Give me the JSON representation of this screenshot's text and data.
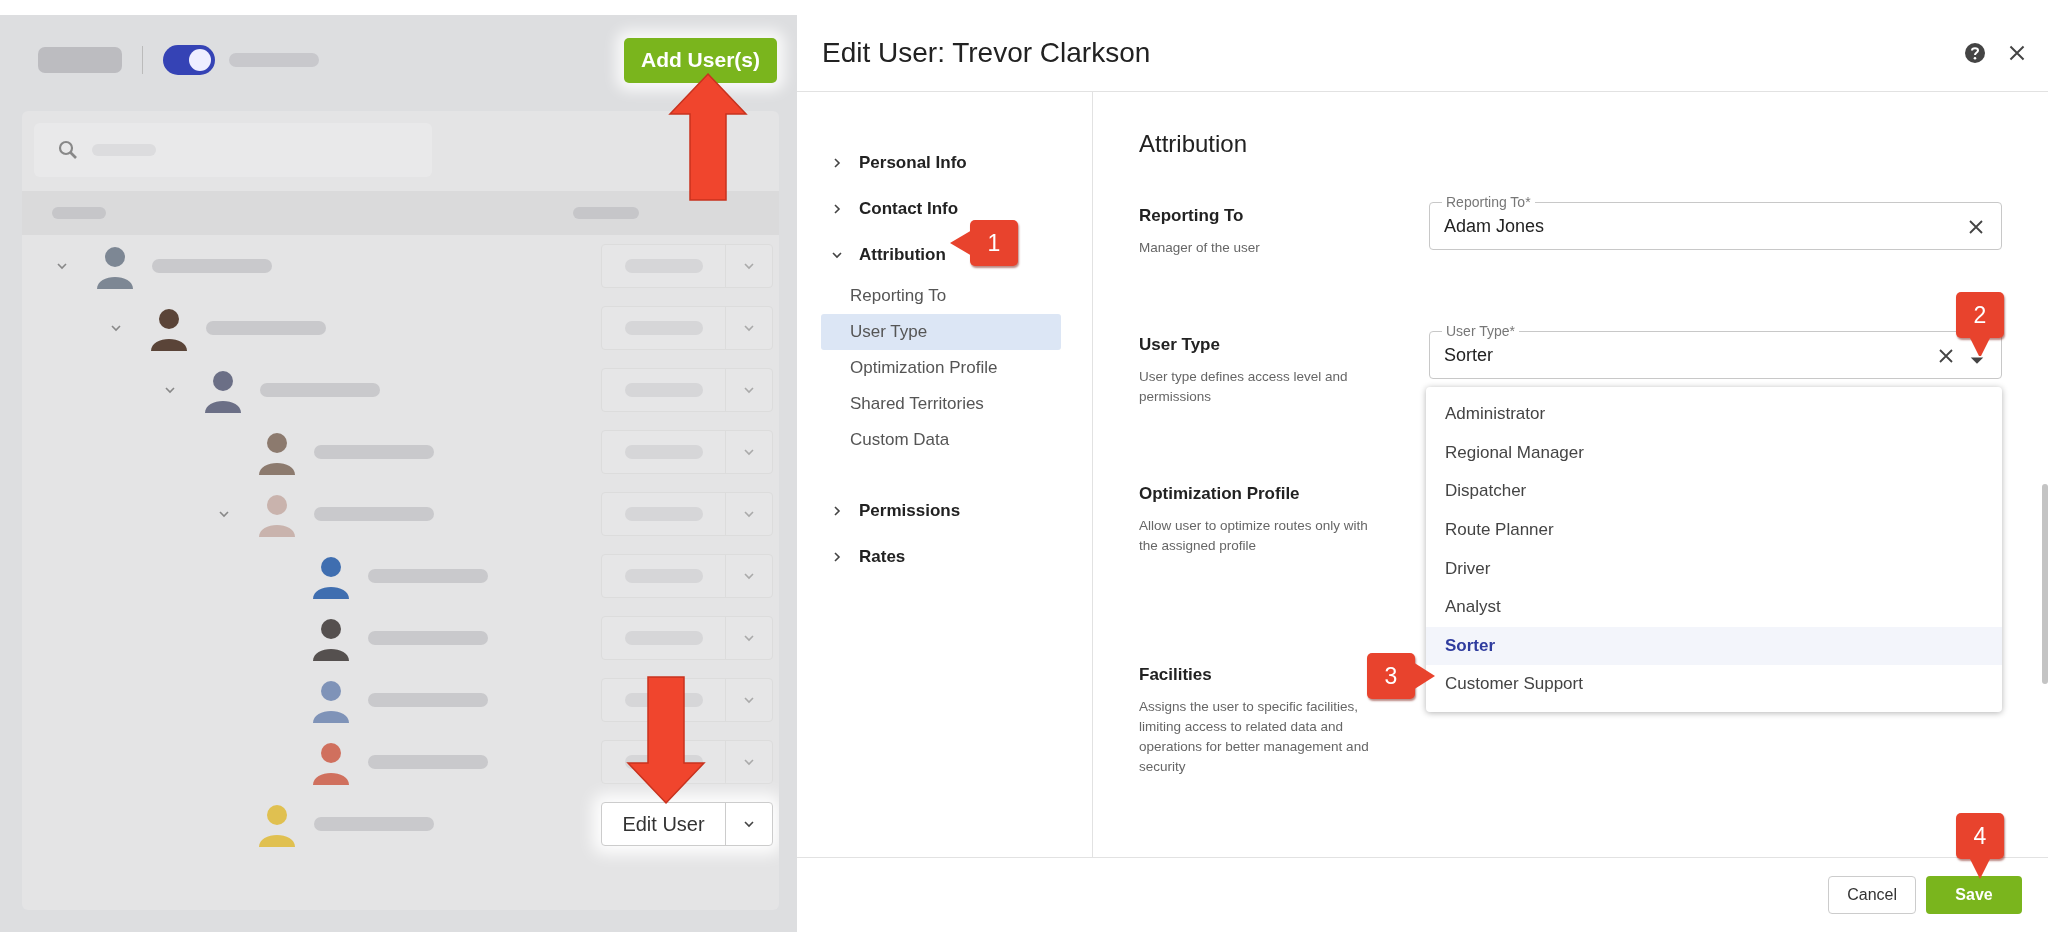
{
  "users_page": {
    "tree_view": {
      "on": true
    },
    "add_button": "Add User(s)",
    "users": [
      {
        "color": "#7d8794",
        "highlighted": false,
        "children": [
          {
            "color": "#5a4438",
            "highlighted": false,
            "children": [
              {
                "color": "#6b6f86",
                "highlighted": false,
                "children": [
                  {
                    "color": "#8c7a6e",
                    "highlighted": false
                  },
                  {
                    "color": "#c9b3ad",
                    "highlighted": false,
                    "children": [
                      {
                        "color": "#3f6eb0",
                        "highlighted": false
                      },
                      {
                        "color": "#55504f",
                        "highlighted": false
                      },
                      {
                        "color": "#7f93b8",
                        "highlighted": false
                      },
                      {
                        "color": "#d0705e",
                        "highlighted": false
                      }
                    ]
                  },
                  {
                    "color": "#e0c050",
                    "highlighted": true,
                    "action": "Edit User"
                  }
                ]
              }
            ]
          }
        ]
      }
    ]
  },
  "dialog": {
    "title": "Edit User: Trevor Clarkson",
    "nav": [
      {
        "label": "Personal Info",
        "expanded": false
      },
      {
        "label": "Contact Info",
        "expanded": false
      },
      {
        "label": "Attribution",
        "expanded": true,
        "children": [
          {
            "label": "Reporting To",
            "selected": false
          },
          {
            "label": "User Type",
            "selected": true
          },
          {
            "label": "Optimization Profile",
            "selected": false
          },
          {
            "label": "Shared Territories",
            "selected": false
          },
          {
            "label": "Custom Data",
            "selected": false
          }
        ]
      },
      {
        "label": "Permissions",
        "expanded": false
      },
      {
        "label": "Rates",
        "expanded": false
      }
    ],
    "section_title": "Attribution",
    "sections": [
      {
        "title": "Reporting To",
        "description": "Manager of the user",
        "field": {
          "kind": "text",
          "label": "Reporting To*",
          "value": "Adam Jones"
        }
      },
      {
        "title": "User Type",
        "description": "User type defines access level and permissions",
        "field": {
          "kind": "select",
          "label": "User Type*",
          "value": "Sorter",
          "open": true,
          "options": [
            {
              "label": "Administrator",
              "selected": false
            },
            {
              "label": "Regional Manager",
              "selected": false
            },
            {
              "label": "Dispatcher",
              "selected": false
            },
            {
              "label": "Route Planner",
              "selected": false
            },
            {
              "label": "Driver",
              "selected": false
            },
            {
              "label": "Analyst",
              "selected": false
            },
            {
              "label": "Sorter",
              "selected": true
            },
            {
              "label": "Customer Support",
              "selected": false
            }
          ]
        }
      },
      {
        "title": "Optimization Profile",
        "description": "Allow user to optimize routes only with the assigned profile"
      },
      {
        "title": "Facilities",
        "description": "Assigns the user to specific facilities, limiting access to related data and operations for better management and security"
      }
    ],
    "buttons": [
      {
        "label": "Cancel",
        "kind": "secondary"
      },
      {
        "label": "Save",
        "kind": "primary"
      }
    ]
  },
  "callouts": [
    {
      "label": "1",
      "kind": "left"
    },
    {
      "label": "2",
      "kind": "down"
    },
    {
      "label": "3",
      "kind": "right"
    },
    {
      "label": "4",
      "kind": "down"
    }
  ],
  "arrows": [
    {
      "kind": "up"
    },
    {
      "kind": "down"
    }
  ]
}
